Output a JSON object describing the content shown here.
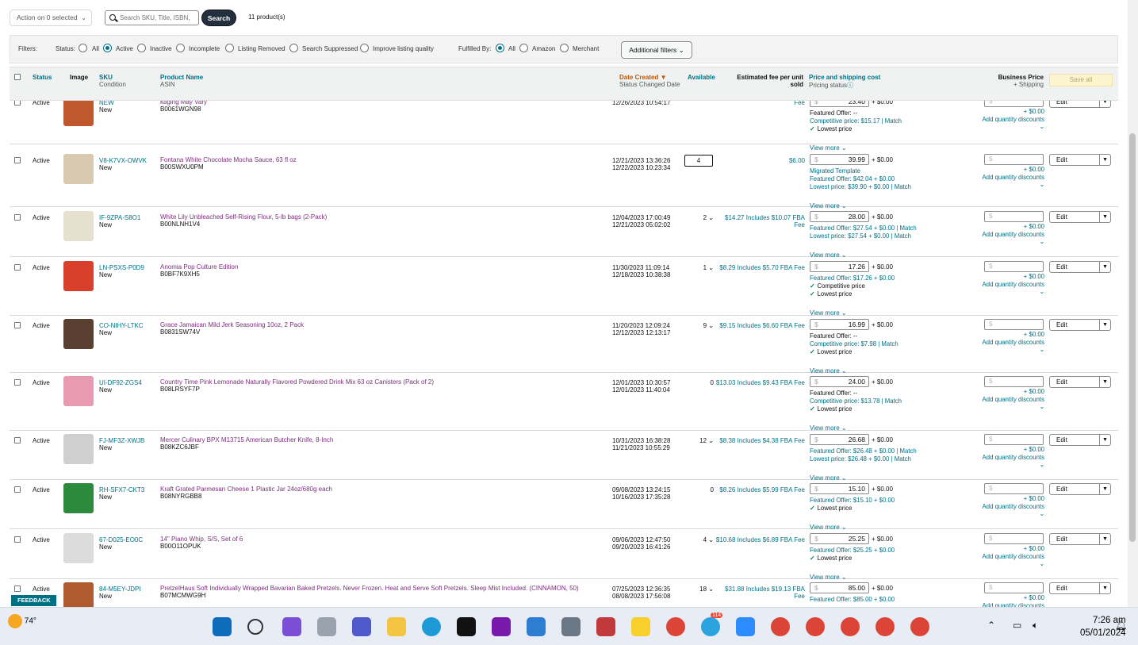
{
  "toolbar": {
    "action_label": "Action on 0 selected",
    "search_placeholder": "Search SKU, Title, ISBN,",
    "search_button": "Search",
    "count": "11 product(s)"
  },
  "filters": {
    "label": "Filters:",
    "status_label": "Status:",
    "status_options": [
      "All",
      "Active",
      "Inactive",
      "Incomplete",
      "Listing Removed",
      "Search Suppressed",
      "Improve listing quality"
    ],
    "status_selected": "Active",
    "fulfilled_label": "Fulfilled By:",
    "fulfilled_options": [
      "All",
      "Amazon",
      "Merchant"
    ],
    "fulfilled_selected": "All",
    "additional": "Additional filters"
  },
  "header": {
    "status": "Status",
    "image": "Image",
    "sku": "SKU",
    "condition": "Condition",
    "product_name": "Product Name",
    "asin": "ASIN",
    "date_created": "Date Created",
    "status_changed": "Status Changed Date",
    "available": "Available",
    "fee": "Estimated fee per unit sold",
    "price": "Price and shipping cost",
    "pricing_status": "Pricing status",
    "business_price": "Business Price",
    "business_ship": "+ Shipping",
    "save_all": "Save all"
  },
  "rows": [
    {
      "status": "Active",
      "sku": "",
      "condition": "NEW",
      "cond2": "New",
      "name": "kaging May Vary",
      "asin": "B0061WGN98",
      "created": "",
      "changed": "12/26/2023 10:54:17",
      "available": "",
      "fee": "Fee",
      "price": "23.40",
      "ship": "+ $0.00",
      "info": [
        [
          "g",
          "Featured Offer: --"
        ],
        [
          "m",
          "Competitive price: $15.17 | Match"
        ],
        [
          "c",
          "Lowest price"
        ]
      ],
      "img": "#c0582e"
    },
    {
      "status": "Active",
      "sku": "V8-K7VX-OWVK",
      "condition": "New",
      "name": "Fontana White Chocolate Mocha Sauce, 63 fl oz",
      "asin": "B00SWXU0PM",
      "created": "12/21/2023 13:36:26",
      "changed": "12/22/2023 10:23:34",
      "available": "4",
      "box": true,
      "fee": "$6.00",
      "price": "39.99",
      "ship": "+ $0.00",
      "info": [
        [
          "m",
          "Migrated Template"
        ],
        [
          "m",
          "Featured Offer: $42.04 + $0.00"
        ],
        [
          "m",
          "Lowest price: $39.90 + $0.00 | Match"
        ]
      ],
      "img": "#d8c9b0"
    },
    {
      "status": "Active",
      "sku": "IF-9ZPA-S8O1",
      "condition": "New",
      "name": "White Lily Unbleached Self-Rising Flour, 5-lb bags (2-Pack)",
      "asin": "B00NLNH1V4",
      "created": "12/04/2023 17:00:49",
      "changed": "12/21/2023 05:02:02",
      "available": "2",
      "fee": "$14.27 Includes $10.07 FBA Fee",
      "price": "28.00",
      "ship": "+ $0.00",
      "info": [
        [
          "m",
          "Featured Offer: $27.54 + $0.00 | Match"
        ],
        [
          "m",
          "Lowest price: $27.54 + $0.00 | Match"
        ]
      ],
      "img": "#e6e0cf"
    },
    {
      "status": "Active",
      "sku": "LN-PSXS-P0D9",
      "condition": "New",
      "name": "Anomia Pop Culture Edition",
      "asin": "B0BF7K9XH5",
      "created": "11/30/2023 11:09:14",
      "changed": "12/18/2023 10:38:38",
      "available": "1",
      "fee": "$8.29 Includes $5.70 FBA Fee",
      "price": "17.26",
      "ship": "+ $0.00",
      "info": [
        [
          "m",
          "Featured Offer: $17.26 + $0.00"
        ],
        [
          "c",
          "Competitive price"
        ],
        [
          "c",
          "Lowest price"
        ]
      ],
      "img": "#d8402b"
    },
    {
      "status": "Active",
      "sku": "CO-NIHY-LTKC",
      "condition": "New",
      "name": "Grace Jamaican Mild Jerk Seasoning 10oz, 2 Pack",
      "asin": "B0831SW74V",
      "created": "11/20/2023 12:09:24",
      "changed": "12/12/2023 12:13:17",
      "available": "9",
      "fee": "$9.15 Includes $6.60 FBA Fee",
      "price": "16.99",
      "ship": "+ $0.00",
      "info": [
        [
          "g",
          "Featured Offer: --"
        ],
        [
          "m",
          "Competitive price: $7.98 | Match"
        ],
        [
          "c",
          "Lowest price"
        ]
      ],
      "img": "#5a4030"
    },
    {
      "status": "Active",
      "sku": "UI-DF92-ZGS4",
      "condition": "New",
      "name": "Country Time Pink Lemonade Naturally Flavored Powdered Drink Mix 63 oz Canisters (Pack of 2)",
      "asin": "B08LRSYF7P",
      "created": "12/01/2023 10:30:57",
      "changed": "12/01/2023 11:40:04",
      "available": "0",
      "fee": "$13.03 Includes $9.43 FBA Fee",
      "price": "24.00",
      "ship": "+ $0.00",
      "info": [
        [
          "g",
          "Featured Offer: --"
        ],
        [
          "m",
          "Competitive price: $13.78 | Match"
        ],
        [
          "c",
          "Lowest price"
        ]
      ],
      "img": "#e89ab0"
    },
    {
      "status": "Active",
      "sku": "FJ-MF3Z-XWJB",
      "condition": "New",
      "name": "Mercer Culinary BPX M13715 American Butcher Knife, 8-Inch",
      "asin": "B08KZC6JBF",
      "created": "10/31/2023 16:38:28",
      "changed": "11/21/2023 10:55:29",
      "available": "12",
      "fee": "$8.38 Includes $4.38 FBA Fee",
      "price": "26.68",
      "ship": "+ $0.00",
      "info": [
        [
          "m",
          "Featured Offer: $26.48 + $0.00 | Match"
        ],
        [
          "m",
          "Lowest price: $26.48 + $0.00 | Match"
        ]
      ],
      "img": "#cfcfcf"
    },
    {
      "status": "Active",
      "sku": "RH-SFX7-CKT3",
      "condition": "New",
      "name": "Kraft Grated Parmesan Cheese 1 Plastic Jar 24oz/680g each",
      "asin": "B08NYRGBB8",
      "created": "09/08/2023 13:24:15",
      "changed": "10/16/2023 17:35:28",
      "available": "0",
      "fee": "$8.26 Includes $5.99 FBA Fee",
      "price": "15.10",
      "ship": "+ $0.00",
      "info": [
        [
          "m",
          "Featured Offer: $15.10 + $0.00"
        ],
        [
          "c",
          "Lowest price"
        ]
      ],
      "img": "#2c8a3c"
    },
    {
      "status": "Active",
      "sku": "67-D025-EO0C",
      "condition": "New",
      "name": "14\" Piano Whip, S/S, Set of 6",
      "asin": "B00O11OPUK",
      "created": "09/06/2023 12:47:50",
      "changed": "09/20/2023 16:41:26",
      "available": "4",
      "fee": "$10.68 Includes $6.89 FBA Fee",
      "price": "25.25",
      "ship": "+ $0.00",
      "info": [
        [
          "m",
          "Featured Offer: $25.25 + $0.00"
        ],
        [
          "c",
          "Lowest price"
        ]
      ],
      "img": "#dcdcdc"
    },
    {
      "status": "Active",
      "sku": "84-M5EY-JDPI",
      "condition": "New",
      "name": "PretzelHaus Soft Individually Wrapped Bavarian Baked Pretzels. Never Frozen. Heat and Serve Soft Pretzels. Sleep Mist Included. (CINNAMON, 50)",
      "asin": "B07MCMWG9H",
      "created": "07/25/2023 12:36:35",
      "changed": "08/08/2023 17:56:08",
      "available": "18",
      "fee": "$31.88 Includes $19.13 FBA Fee",
      "price": "85.00",
      "ship": "+ $0.00",
      "info": [
        [
          "m",
          "Featured Offer: $85.00 + $0.00"
        ]
      ],
      "img": "#b05a30"
    }
  ],
  "row_common": {
    "view_more": "View more",
    "edit": "Edit",
    "bship": "+ $0.00",
    "bqty": "Add quantity discounts",
    "dollar": "$"
  },
  "feedback": "FEEDBACK",
  "taskbar": {
    "temp": "74°",
    "time": "7:26 am",
    "date": "05/01/2024",
    "telegram_badge": "114"
  }
}
